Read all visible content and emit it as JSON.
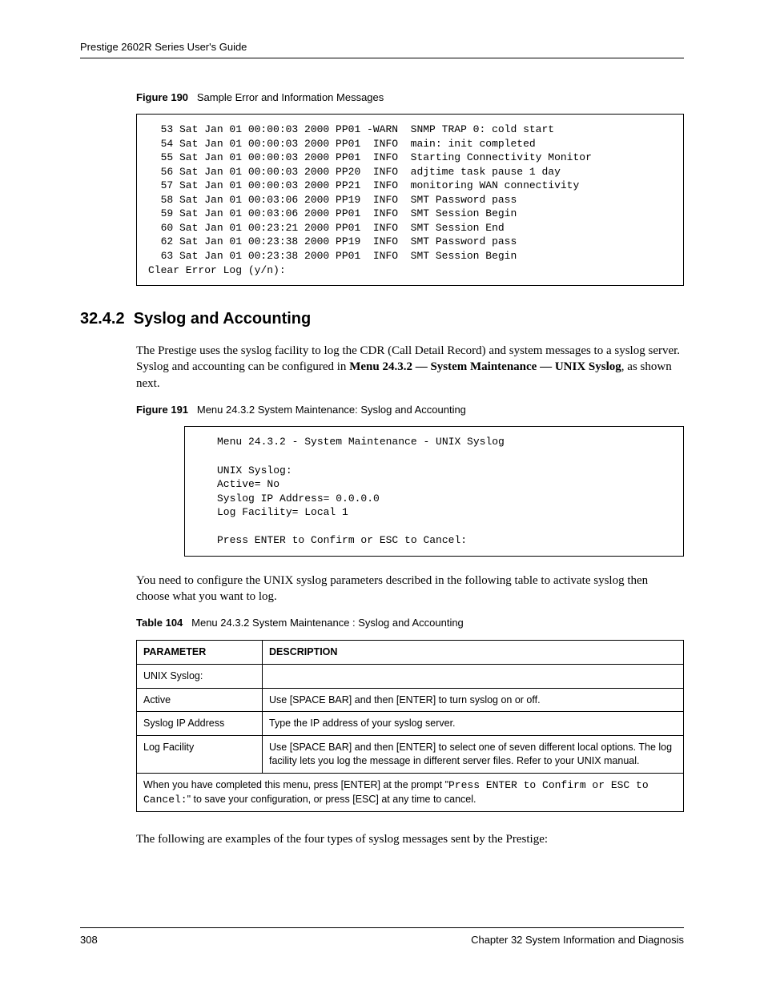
{
  "header": "Prestige 2602R Series User's Guide",
  "figure190": {
    "label": "Figure 190",
    "title": "Sample Error and Information Messages",
    "content": "  53 Sat Jan 01 00:00:03 2000 PP01 -WARN  SNMP TRAP 0: cold start\n  54 Sat Jan 01 00:00:03 2000 PP01  INFO  main: init completed\n  55 Sat Jan 01 00:00:03 2000 PP01  INFO  Starting Connectivity Monitor\n  56 Sat Jan 01 00:00:03 2000 PP20  INFO  adjtime task pause 1 day\n  57 Sat Jan 01 00:00:03 2000 PP21  INFO  monitoring WAN connectivity\n  58 Sat Jan 01 00:03:06 2000 PP19  INFO  SMT Password pass\n  59 Sat Jan 01 00:03:06 2000 PP01  INFO  SMT Session Begin\n  60 Sat Jan 01 00:23:21 2000 PP01  INFO  SMT Session End\n  62 Sat Jan 01 00:23:38 2000 PP19  INFO  SMT Password pass\n  63 Sat Jan 01 00:23:38 2000 PP01  INFO  SMT Session Begin\nClear Error Log (y/n):"
  },
  "section": {
    "number": "32.4.2",
    "title": "Syslog and Accounting"
  },
  "para1_a": "The Prestige uses the syslog facility to log the CDR (Call Detail Record) and system messages to a syslog server. Syslog and accounting can be configured in ",
  "para1_b": "Menu 24.3.2 — System Maintenance — UNIX Syslog",
  "para1_c": ", as shown next.",
  "figure191": {
    "label": "Figure 191",
    "title": "Menu 24.3.2 System Maintenance: Syslog and Accounting",
    "content": "Menu 24.3.2 - System Maintenance - UNIX Syslog\n\nUNIX Syslog:\nActive= No\nSyslog IP Address= 0.0.0.0\nLog Facility= Local 1\n\nPress ENTER to Confirm or ESC to Cancel:"
  },
  "para2": "You need to configure the UNIX syslog parameters described in the following table to activate syslog then choose what you want to log.",
  "table104": {
    "label": "Table 104",
    "title": "Menu 24.3.2 System Maintenance : Syslog and Accounting",
    "head_param": "PARAMETER",
    "head_desc": "DESCRIPTION",
    "rows": [
      {
        "param": "UNIX Syslog:",
        "desc": ""
      },
      {
        "param": "Active",
        "desc": "Use [SPACE BAR] and then [ENTER] to turn syslog on or off."
      },
      {
        "param": "Syslog IP Address",
        "desc": "Type the IP address of your syslog server."
      },
      {
        "param": "Log Facility",
        "desc": "Use [SPACE BAR] and then [ENTER] to select one of seven different local options. The log facility lets you log the message in different server files. Refer to your UNIX manual."
      }
    ],
    "footnote_a": "When you have completed this menu, press [ENTER] at the prompt \"",
    "footnote_mono": "Press ENTER to Confirm or ESC to Cancel:",
    "footnote_b": "\" to save your configuration, or press [ESC] at any time to cancel."
  },
  "para3": "The following are examples of the four types of syslog messages sent by the Prestige:",
  "footer": {
    "page": "308",
    "chapter": "Chapter 32 System Information and Diagnosis"
  }
}
